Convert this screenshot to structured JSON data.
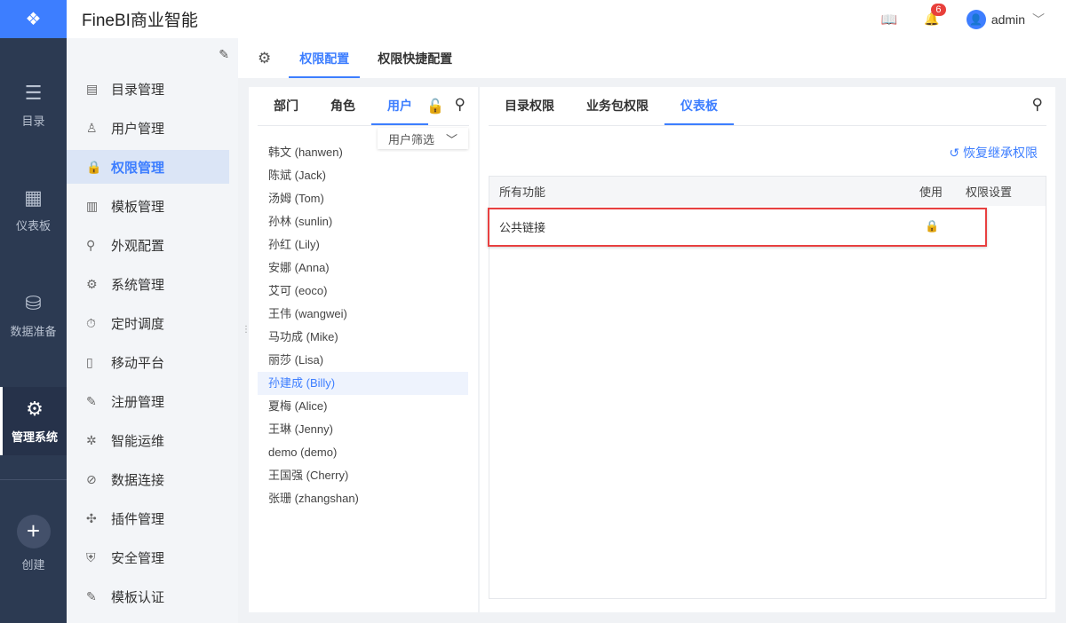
{
  "app": {
    "title": "FineBI商业智能"
  },
  "header": {
    "notifications": "6",
    "user": "admin"
  },
  "rail": [
    {
      "label": "目录",
      "icon": "list-icon"
    },
    {
      "label": "仪表板",
      "icon": "dashboard-icon"
    },
    {
      "label": "数据准备",
      "icon": "database-icon"
    },
    {
      "label": "管理系统",
      "icon": "gear-icon"
    },
    {
      "label": "创建",
      "icon": "plus-icon"
    }
  ],
  "sidebar": [
    {
      "label": "目录管理"
    },
    {
      "label": "用户管理"
    },
    {
      "label": "权限管理"
    },
    {
      "label": "模板管理"
    },
    {
      "label": "外观配置"
    },
    {
      "label": "系统管理"
    },
    {
      "label": "定时调度"
    },
    {
      "label": "移动平台"
    },
    {
      "label": "注册管理"
    },
    {
      "label": "智能运维"
    },
    {
      "label": "数据连接"
    },
    {
      "label": "插件管理"
    },
    {
      "label": "安全管理"
    },
    {
      "label": "模板认证"
    }
  ],
  "tabs": [
    "权限配置",
    "权限快捷配置"
  ],
  "left": {
    "tabs": [
      "部门",
      "角色",
      "用户"
    ],
    "filter": "用户筛选",
    "users": [
      "韩文 (hanwen)",
      "陈斌 (Jack)",
      "汤姆 (Tom)",
      "孙林 (sunlin)",
      "孙红 (Lily)",
      "安娜 (Anna)",
      "艾可 (eoco)",
      "王伟 (wangwei)",
      "马功成 (Mike)",
      "丽莎 (Lisa)",
      "孙建成 (Billy)",
      "夏梅 (Alice)",
      "王琳 (Jenny)",
      "demo (demo)",
      "王国强 (Cherry)",
      "张珊 (zhangshan)"
    ]
  },
  "right": {
    "tabs": [
      "目录权限",
      "业务包权限",
      "仪表板"
    ],
    "restore": "恢复继承权限",
    "columns": [
      "所有功能",
      "使用",
      "权限设置"
    ],
    "rows": [
      {
        "name": "公共链接"
      }
    ]
  }
}
